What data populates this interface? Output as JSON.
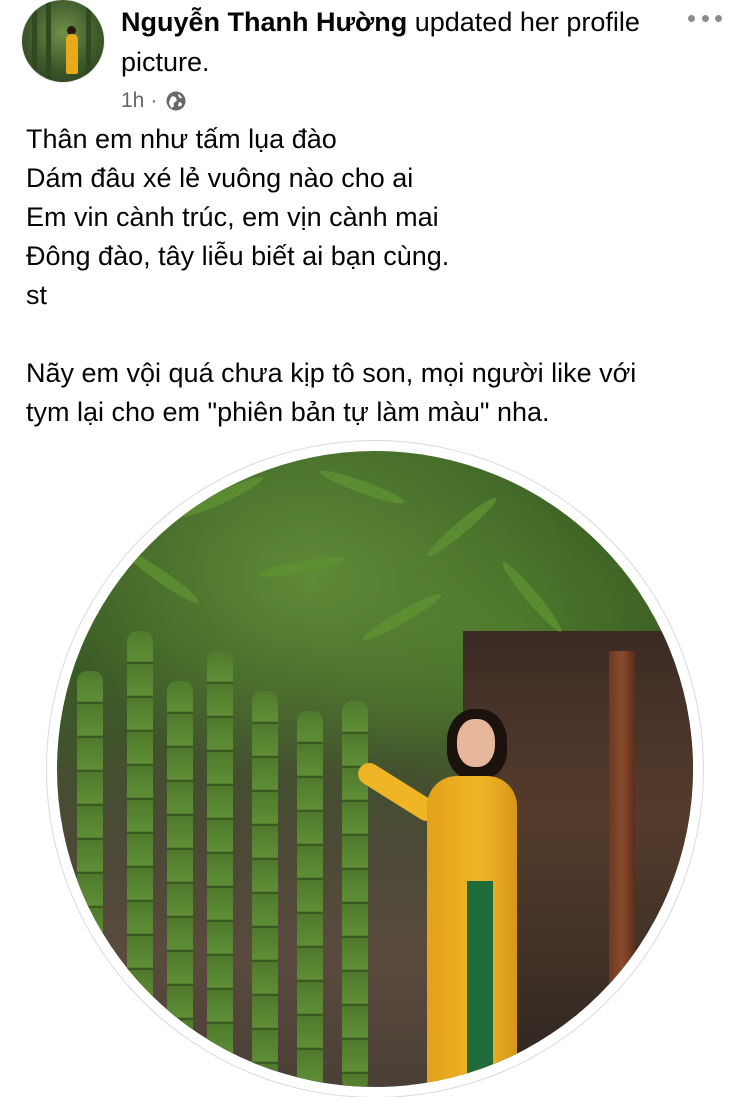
{
  "post": {
    "author_name": "Nguyễn Thanh Hường",
    "author_action": " updated her profile picture.",
    "timestamp": "1h",
    "separator": "·",
    "privacy_icon": "globe-icon",
    "more_icon": "more-horizontal-icon",
    "text_lines": [
      "Thân em như tấm lụa đào",
      "Dám đâu xé lẻ vuông nào cho ai",
      "Em vin cành trúc, em vịn cành mai",
      "Đông đào, tây liễu biết ai bạn cùng.",
      "st",
      "",
      "Nãy em vội quá chưa kịp tô son, mọi người like với",
      "tym lại cho em \"phiên bản tự làm màu\" nha."
    ]
  },
  "colors": {
    "text_primary": "#050505",
    "text_secondary": "#65676b",
    "frame_border": "#d8dadf"
  }
}
